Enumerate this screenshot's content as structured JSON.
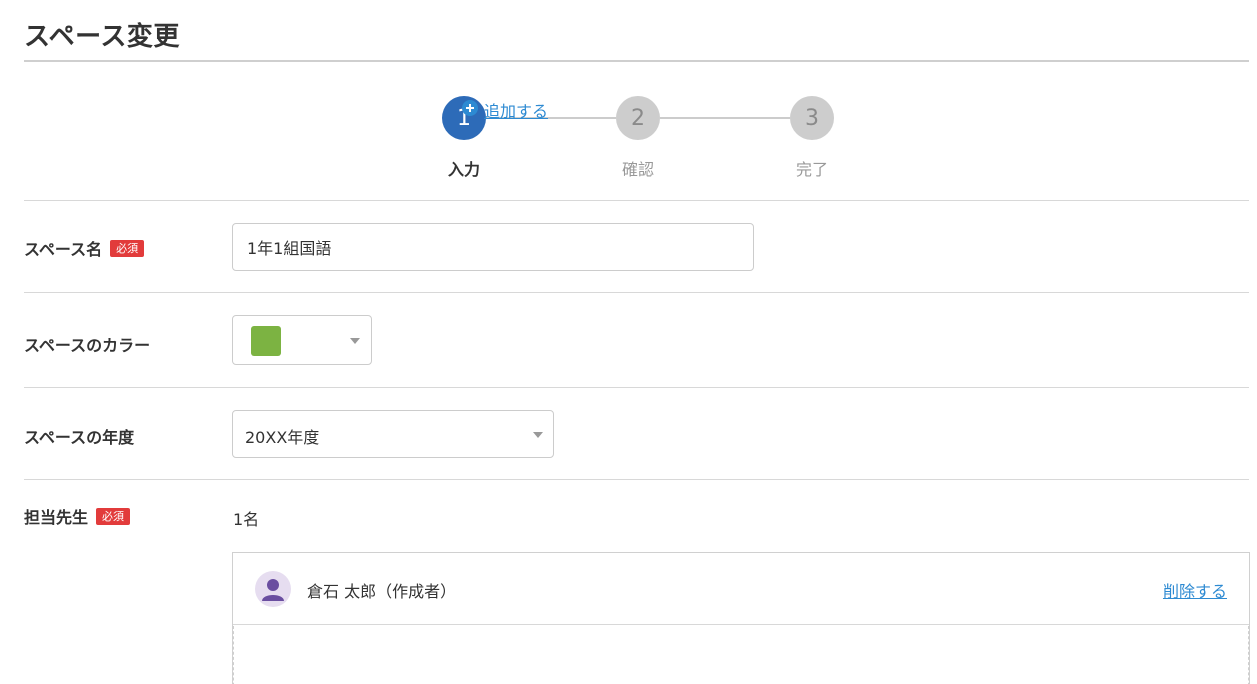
{
  "page": {
    "title": "スペース変更"
  },
  "stepper": {
    "steps": [
      {
        "number": "1",
        "label": "入力",
        "state": "active"
      },
      {
        "number": "2",
        "label": "確認",
        "state": "inactive"
      },
      {
        "number": "3",
        "label": "完了",
        "state": "inactive"
      }
    ]
  },
  "form": {
    "required_label": "必須",
    "space_name": {
      "label": "スペース名",
      "value": "1年1組国語"
    },
    "space_color": {
      "label": "スペースのカラー",
      "selected_color": "#7cb342"
    },
    "space_year": {
      "label": "スペースの年度",
      "value": "20XX年度"
    },
    "teachers": {
      "label": "担当先生",
      "count": "1名",
      "items": [
        {
          "name": "倉石 太郎（作成者）",
          "delete_label": "削除する"
        }
      ],
      "add_label": "追加する"
    }
  },
  "colors": {
    "accent": "#2d6bb8",
    "link": "#2d8ad2",
    "required": "#e23b3b"
  }
}
